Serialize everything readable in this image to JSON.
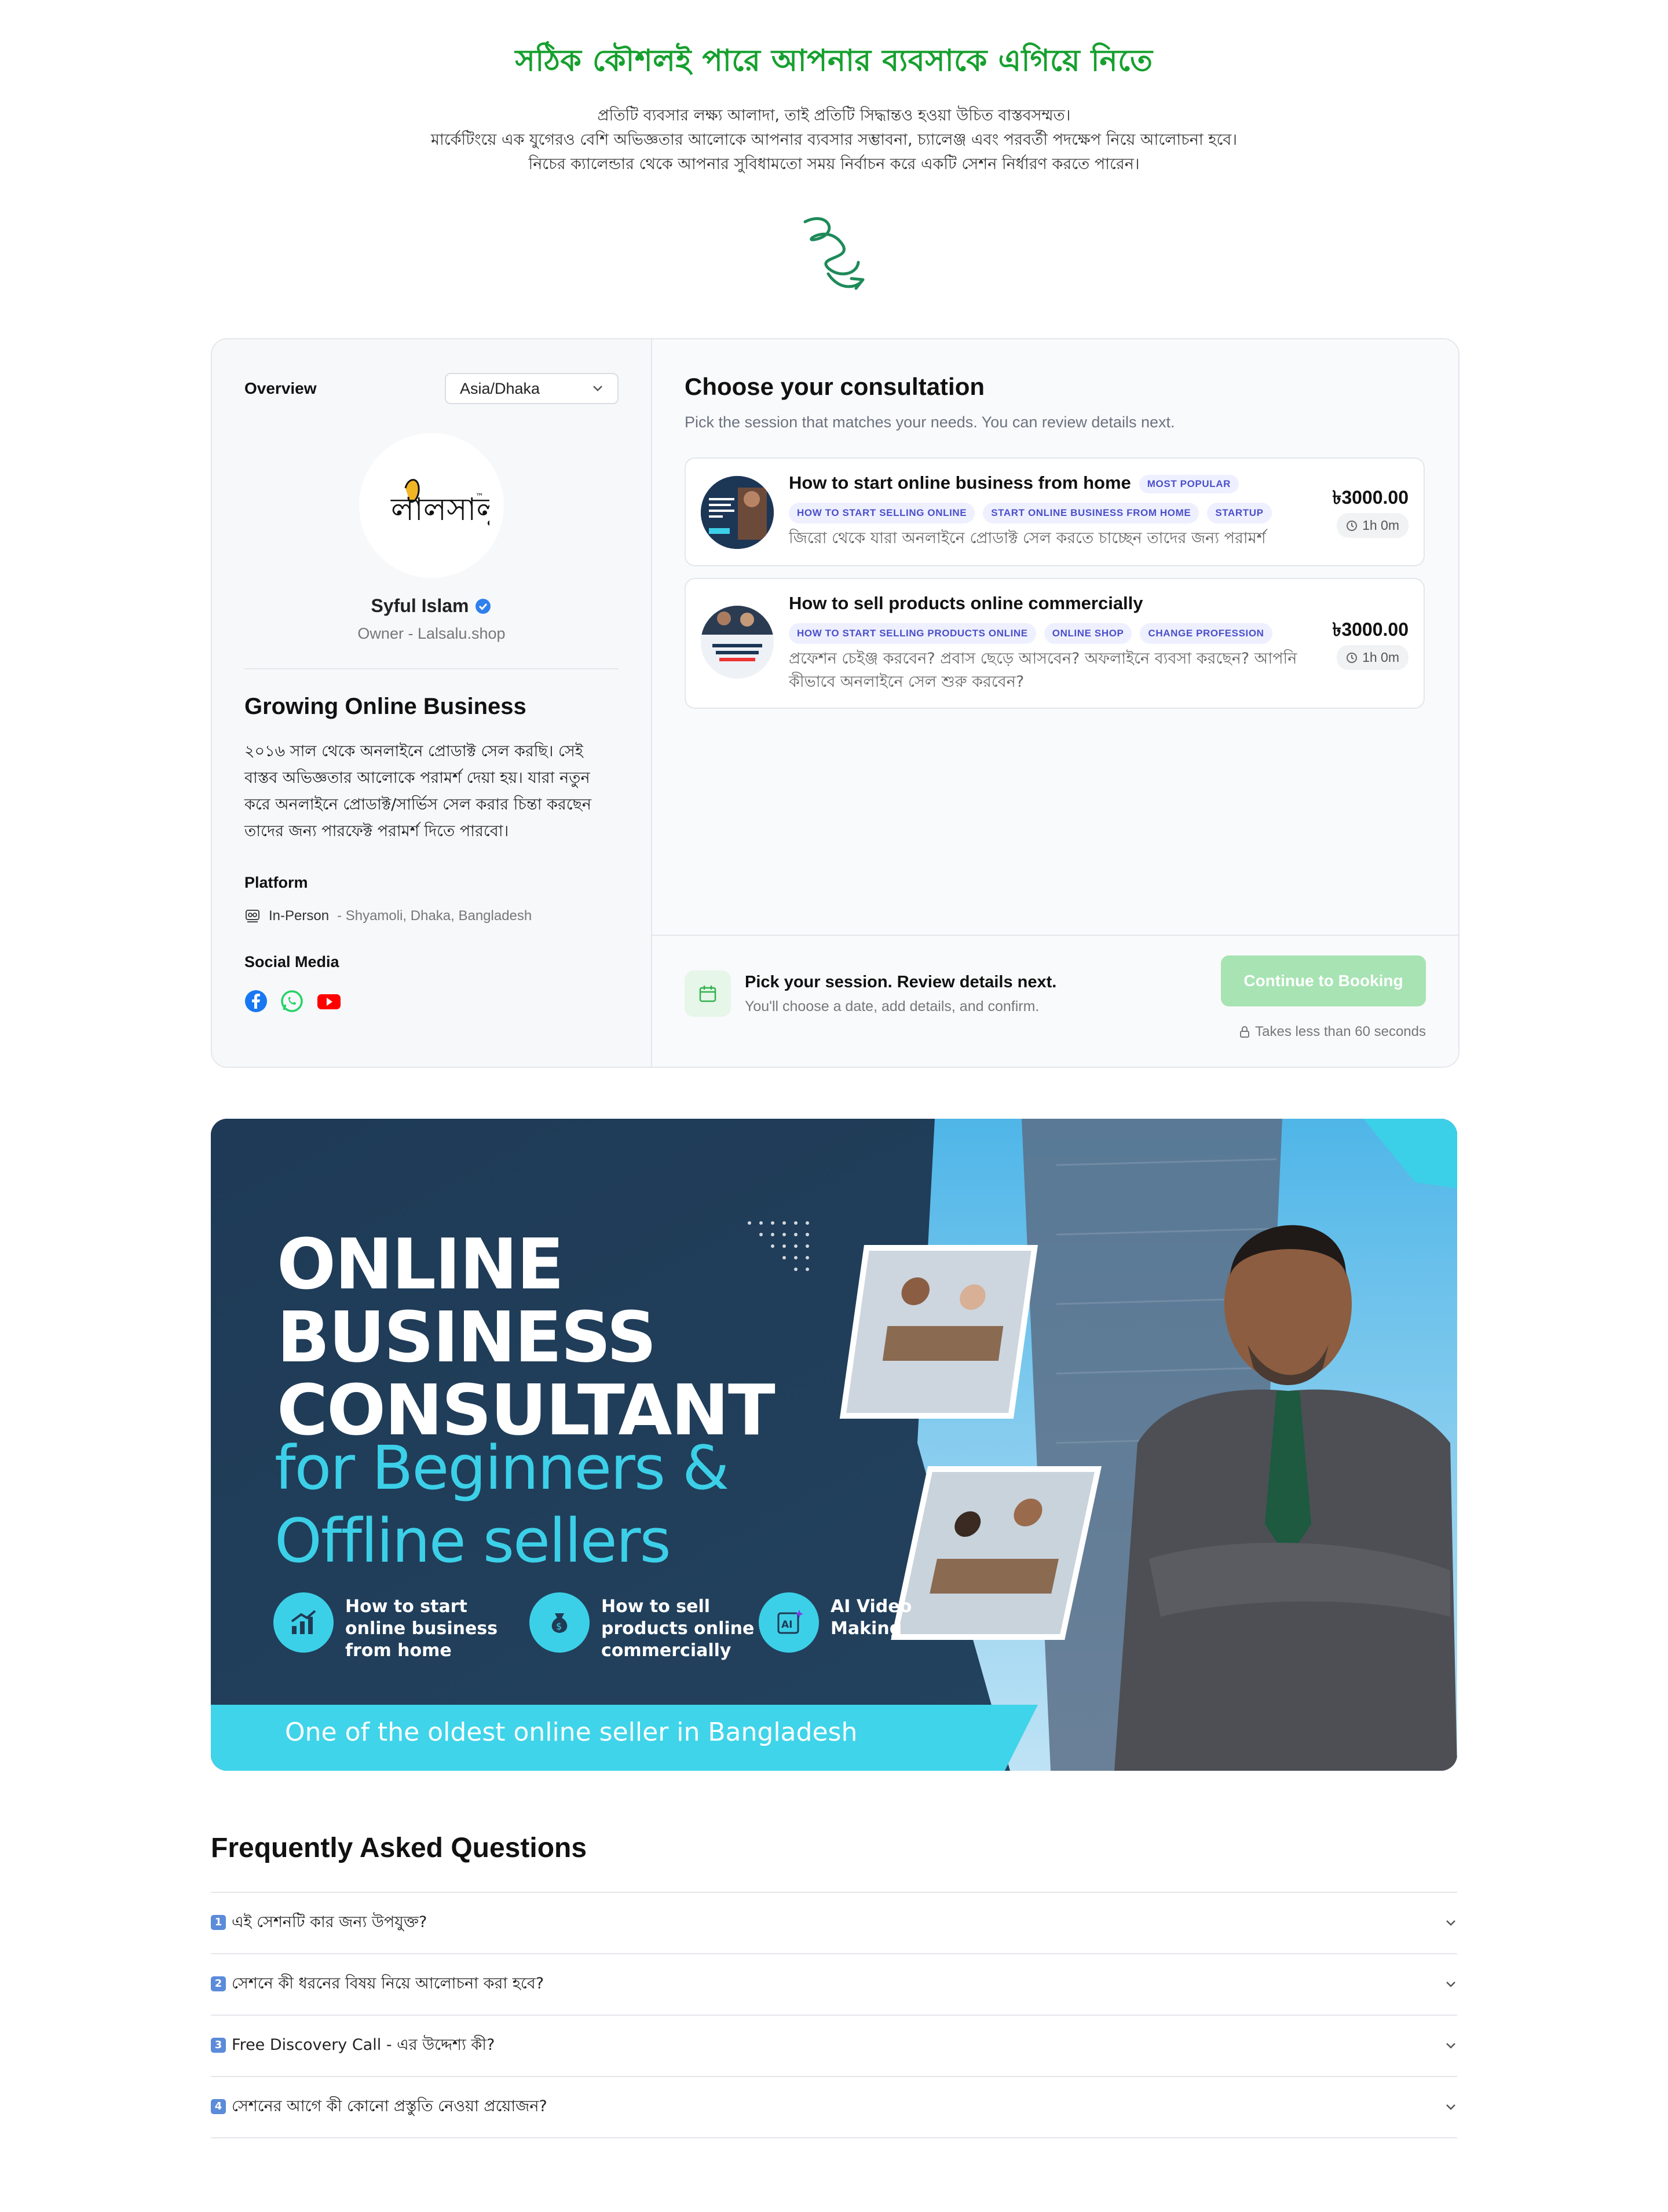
{
  "hero": {
    "title": "সঠিক কৌশলই পারে আপনার ব্যবসাকে এগিয়ে নিতে",
    "lines": [
      "প্রতিটি ব্যবসার লক্ষ্য আলাদা, তাই প্রতিটি সিদ্ধান্তও হওয়া উচিত বাস্তবসম্মত।",
      "মার্কেটিংয়ে এক যুগেরও বেশি অভিজ্ঞতার আলোকে আপনার ব্যবসার সম্ভাবনা, চ্যালেঞ্জ এবং পরবর্তী পদক্ষেপ নিয়ে আলোচনা হবে।",
      "নিচের ক্যালেন্ডার থেকে আপনার সুবিধামতো সময় নির্বাচন করে একটি সেশন নির্ধারণ করতে পারেন।"
    ]
  },
  "overview": {
    "title": "Overview",
    "timezone": "Asia/Dhaka",
    "logo_text": "লালসালু",
    "name": "Syful Islam",
    "role": "Owner - Lalsalu.shop",
    "about_title": "Growing Online Business",
    "about_text": "২০১৬ সাল থেকে অনলাইনে প্রোডাক্ট সেল করছি। সেই বাস্তব অভিজ্ঞতার আলোকে পরামর্শ দেয়া হয়। যারা নতুন করে অনলাইনে প্রোডাক্ট/সার্ভিস সেল করার চিন্তা করছেন তাদের জন্য পারফেক্ট পরামর্শ দিতে পারবো।",
    "platform_label": "Platform",
    "platform_type": "In-Person",
    "platform_location": "- Shyamoli, Dhaka, Bangladesh",
    "social_label": "Social Media",
    "social": [
      "facebook-icon",
      "whatsapp-icon",
      "youtube-icon"
    ]
  },
  "consultation": {
    "title": "Choose your consultation",
    "subtitle": "Pick the session that matches your needs. You can review details next.",
    "services": [
      {
        "title": "How to start online business from home",
        "badge": "MOST POPULAR",
        "tags": [
          "HOW TO START SELLING ONLINE",
          "START ONLINE BUSINESS FROM HOME",
          "STARTUP"
        ],
        "desc": "জিরো থেকে যারা অনলাইনে প্রোডাক্ট সেল করতে চাচ্ছেন তাদের জন্য পরামর্শ",
        "price": "৳3000.00",
        "duration": "1h 0m"
      },
      {
        "title": "How to sell products online commercially",
        "tags": [
          "HOW TO START SELLING PRODUCTS ONLINE",
          "ONLINE SHOP",
          "CHANGE PROFESSION"
        ],
        "desc": "প্রফেশন চেইঞ্জ করবেন? প্রবাস ছেড়ে আসবেন? অফলাইনে ব্যবসা করছেন? আপনি কীভাবে অনলাইনে সেল শুরু করবেন?",
        "price": "৳3000.00",
        "duration": "1h 0m"
      }
    ],
    "footer_title": "Pick your session. Review details next.",
    "footer_sub": "You'll choose a date, add details, and confirm.",
    "cta": "Continue to Booking",
    "note": "Takes less than 60 seconds"
  },
  "banner": {
    "headline": [
      "ONLINE",
      "BUSINESS",
      "CONSULTANT"
    ],
    "subline": [
      "for Beginners &",
      "Offline sellers"
    ],
    "features": [
      "How to start\nonline business\nfrom home",
      "How to sell\nproducts online\ncommercially",
      "AI Video\nMaking"
    ],
    "strip": "One of the oldest online seller in Bangladesh",
    "colors": {
      "accent": "#3cd0e8",
      "bg": "#1f3a55"
    }
  },
  "faq": {
    "title": "Frequently Asked Questions",
    "items": [
      {
        "num": "1",
        "q": "এই সেশনটি কার জন্য উপযুক্ত?"
      },
      {
        "num": "2",
        "q": "সেশনে কী ধরনের বিষয় নিয়ে আলোচনা করা হবে?"
      },
      {
        "num": "3",
        "q": "Free Discovery Call - এর উদ্দেশ্য কী?"
      },
      {
        "num": "4",
        "q": "সেশনের আগে কী কোনো প্রস্তুতি নেওয়া প্রয়োজন?"
      }
    ]
  },
  "colors": {
    "brand_green": "#16a02e",
    "cta_disabled": "#a7e3b3",
    "tag_bg": "#eef0ff",
    "tag_fg": "#4b4fc9"
  }
}
